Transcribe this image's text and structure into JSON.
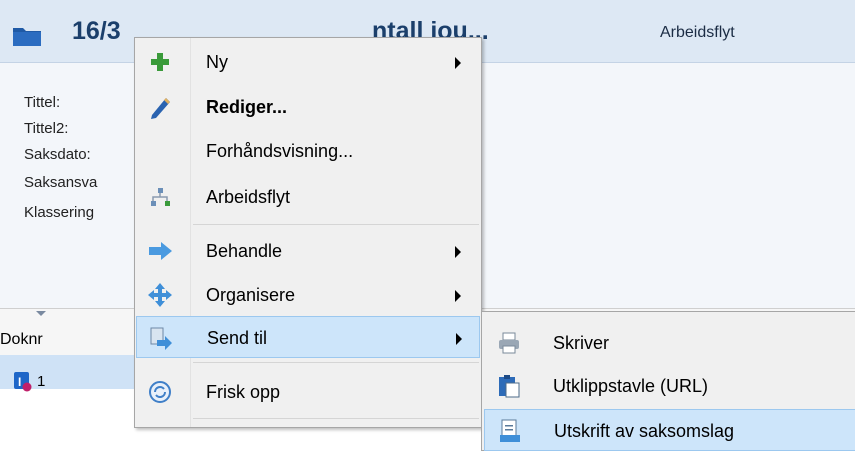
{
  "header": {
    "case_title": "16/3541 Skann Import - Antall jou...",
    "case_title_left": "16/3",
    "case_title_tail": "ntall jou...",
    "workflow_label": "Arbeidsflyt"
  },
  "details": {
    "fields": [
      "Tittel:",
      "Tittel2:",
      "Saksdato:",
      "Saksansva",
      "Klassering"
    ]
  },
  "grid": {
    "column_doknr": "Doknr",
    "row_number": "1"
  },
  "context_menu": {
    "items": [
      {
        "label": "Ny",
        "icon": "green-plus-icon",
        "submenu": true
      },
      {
        "label": "Rediger...",
        "icon": "pencil-icon",
        "bold": true
      },
      {
        "label": "Forhåndsvisning...",
        "icon": ""
      },
      {
        "label": "Arbeidsflyt",
        "icon": "workflow-icon"
      },
      {
        "label": "Behandle",
        "icon": "blue-arrow-icon",
        "submenu": true
      },
      {
        "label": "Organisere",
        "icon": "move-cross-icon",
        "submenu": true
      },
      {
        "label": "Send til",
        "icon": "send-to-icon",
        "submenu": true,
        "highlighted": true
      },
      {
        "label": "Frisk opp",
        "icon": "refresh-icon"
      }
    ]
  },
  "submenu": {
    "items": [
      {
        "label": "Skriver",
        "icon": "printer-icon"
      },
      {
        "label": "Utklippstavle (URL)",
        "icon": "clipboard-icon"
      },
      {
        "label": "Utskrift av saksomslag",
        "icon": "document-print-icon",
        "highlighted": true
      }
    ]
  },
  "colors": {
    "header_bg": "#dde8f4",
    "title_color": "#1b3f6b",
    "highlight_bg": "#cde5fa",
    "menu_bg": "#f0f0f0"
  }
}
